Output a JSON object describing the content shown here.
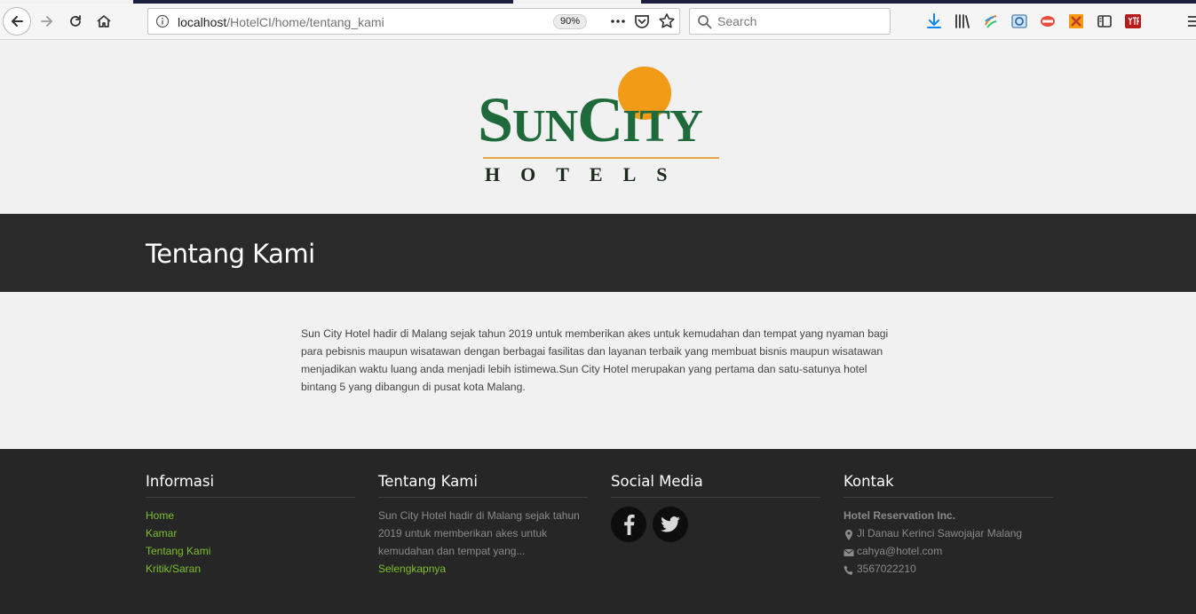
{
  "browser": {
    "url_host": "localhost",
    "url_path": "/HotelCI/home/tentang_kami",
    "zoom": "90%",
    "search_placeholder": "Search"
  },
  "logo": {
    "word_sun_cap": "S",
    "word_sun_rest": "UN",
    "word_city_cap": "C",
    "word_city_rest": "ITY",
    "tagline": "HOTELS",
    "colors": {
      "green": "#1e6a3b",
      "sun": "#f19b16"
    }
  },
  "page": {
    "title": "Tentang Kami",
    "body": "Sun City Hotel hadir di Malang sejak tahun 2019 untuk memberikan akes untuk kemudahan dan tempat yang nyaman bagi para pebisnis maupun wisatawan dengan berbagai fasilitas dan layanan terbaik yang membuat bisnis maupun wisatawan menjadikan waktu luang anda menjadi lebih istimewa.Sun City Hotel merupakan yang pertama dan satu-satunya hotel bintang 5 yang dibangun di pusat kota Malang."
  },
  "footer": {
    "informasi": {
      "title": "Informasi",
      "links": [
        "Home",
        "Kamar",
        "Tentang Kami",
        "Kritik/Saran"
      ]
    },
    "tentang": {
      "title": "Tentang Kami",
      "excerpt": "Sun City Hotel hadir di Malang sejak tahun 2019 untuk memberikan akes untuk kemudahan dan tempat yang...",
      "more": "Selengkapnya"
    },
    "social": {
      "title": "Social Media",
      "icons": [
        "facebook-icon",
        "twitter-icon"
      ]
    },
    "kontak": {
      "title": "Kontak",
      "name": "Hotel Reservation Inc.",
      "address": "Jl Danau Kerinci Sawojajar Malang",
      "email": "cahya@hotel.com",
      "phone": "3567022210"
    },
    "link_color": "#7fbf2a"
  }
}
